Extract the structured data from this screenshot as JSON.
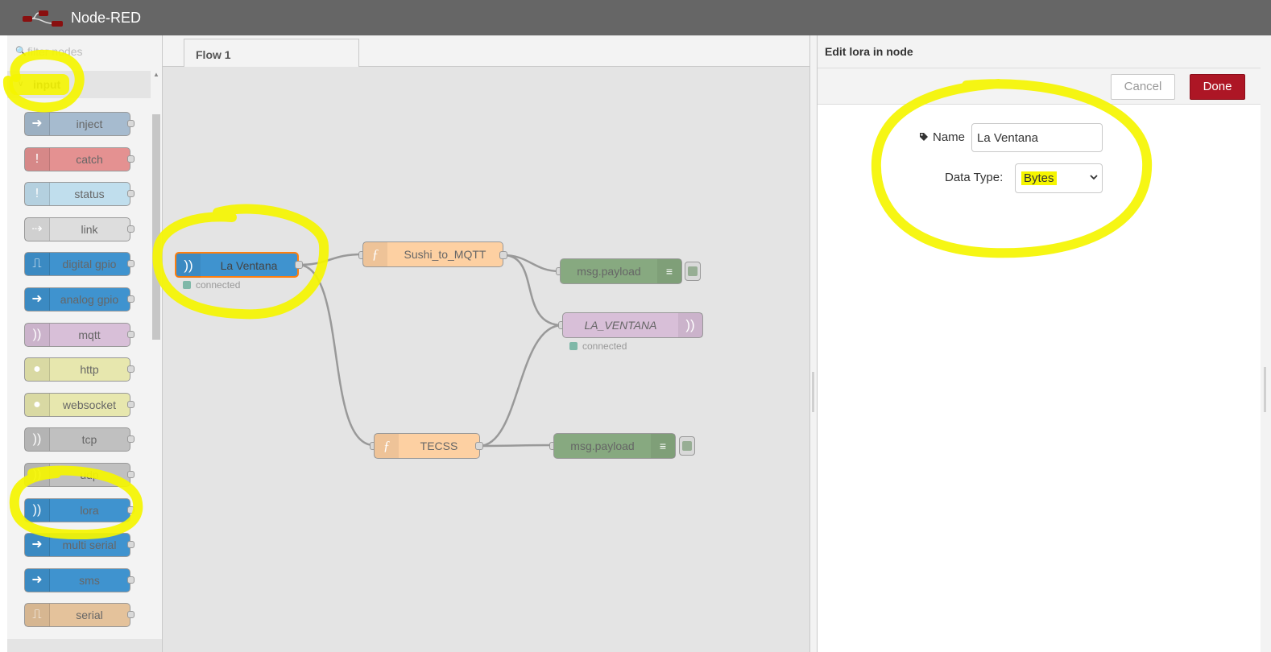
{
  "header": {
    "title": "Node-RED"
  },
  "palette": {
    "filter_placeholder": "filter nodes",
    "category": "input",
    "nodes": [
      {
        "label": "inject",
        "icon": "arrow-right-icon",
        "color": "#a6bbcf"
      },
      {
        "label": "catch",
        "icon": "exclamation-icon",
        "color": "#e49191"
      },
      {
        "label": "status",
        "icon": "exclamation-icon",
        "color": "#c0deed"
      },
      {
        "label": "link",
        "icon": "link-arrow-icon",
        "color": "#dddddd"
      },
      {
        "label": "digital gpio",
        "icon": "pulse-icon",
        "color": "#3f93cf"
      },
      {
        "label": "analog gpio",
        "icon": "arrow-right-icon",
        "color": "#3f93cf"
      },
      {
        "label": "mqtt",
        "icon": "radio-waves-icon",
        "color": "#d8bfd8"
      },
      {
        "label": "http",
        "icon": "globe-icon",
        "color": "#e7e7ae"
      },
      {
        "label": "websocket",
        "icon": "globe-icon",
        "color": "#e7e7ae"
      },
      {
        "label": "tcp",
        "icon": "radio-waves-icon",
        "color": "#c0c0c0"
      },
      {
        "label": "udp",
        "icon": "radio-waves-icon",
        "color": "#c0c0c0"
      },
      {
        "label": "lora",
        "icon": "radio-waves-icon",
        "color": "#3f93cf"
      },
      {
        "label": "multi serial",
        "icon": "arrow-right-icon",
        "color": "#3f93cf"
      },
      {
        "label": "sms",
        "icon": "arrow-right-icon",
        "color": "#3f93cf"
      },
      {
        "label": "serial",
        "icon": "pulse-icon",
        "color": "#e4c29b"
      }
    ]
  },
  "workspace": {
    "tab": "Flow 1",
    "nodes": {
      "la_ventana": {
        "label": "La Ventana",
        "status": "connected"
      },
      "sushi": {
        "label": "Sushi_to_MQTT"
      },
      "msg1": {
        "label": "msg.payload"
      },
      "la_ventana_out": {
        "label": "LA_VENTANA",
        "status": "connected"
      },
      "tecss": {
        "label": "TECSS"
      },
      "msg2": {
        "label": "msg.payload"
      }
    }
  },
  "editor": {
    "title": "Edit lora in node",
    "cancel": "Cancel",
    "done": "Done",
    "name_label": "Name",
    "name_value": "La Ventana",
    "datatype_label": "Data Type:",
    "datatype_value": "Bytes"
  },
  "colors": {
    "header": "#666666",
    "done_button": "#ad1625",
    "highlighter": "#f5f500",
    "function_node": "#fdd0a2",
    "debug_node": "#87a980",
    "lora_node": "#3f93cf",
    "mqtt_node": "#d8bfd8"
  }
}
